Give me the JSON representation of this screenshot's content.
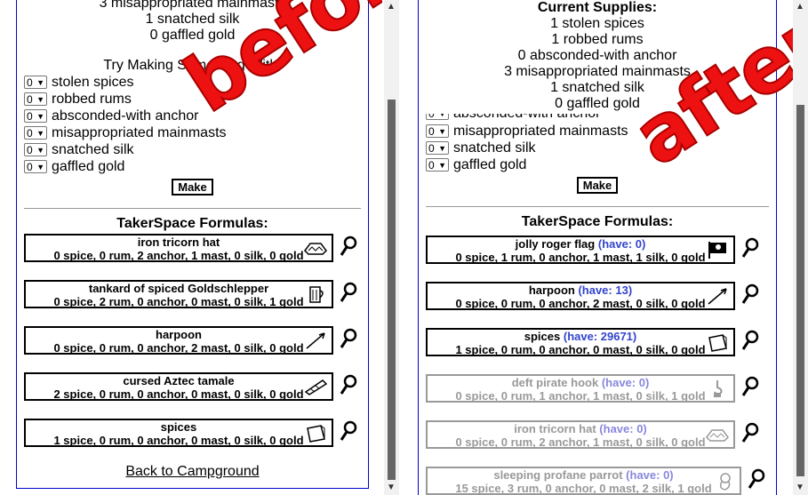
{
  "left": {
    "supplies_partial": [
      "3 misappropriated mainmasts",
      "1 snatched silk",
      "0 gaffled gold"
    ],
    "try_title": "Try Making Something With:",
    "ingredients": [
      {
        "qty": "0",
        "label": "stolen spices"
      },
      {
        "qty": "0",
        "label": "robbed rums"
      },
      {
        "qty": "0",
        "label": "absconded-with anchor"
      },
      {
        "qty": "0",
        "label": "misappropriated mainmasts"
      },
      {
        "qty": "0",
        "label": "snatched silk"
      },
      {
        "qty": "0",
        "label": "gaffled gold"
      }
    ],
    "make_label": "Make",
    "formulas_title": "TakerSpace Formulas:",
    "formulas": [
      {
        "name": "iron tricorn hat",
        "have": "",
        "recipe": "0 spice, 0 rum, 2 anchor, 1 mast, 0 silk, 0 gold",
        "icon": "hat-icon"
      },
      {
        "name": "tankard of spiced Goldschlepper",
        "have": "",
        "recipe": "0 spice, 2 rum, 0 anchor, 0 mast, 0 silk, 1 gold",
        "icon": "tankard-icon"
      },
      {
        "name": "harpoon",
        "have": "",
        "recipe": "0 spice, 0 rum, 0 anchor, 2 mast, 0 silk, 0 gold",
        "icon": "harpoon-icon"
      },
      {
        "name": "cursed Aztec tamale",
        "have": "",
        "recipe": "2 spice, 0 rum, 0 anchor, 0 mast, 0 silk, 0 gold",
        "icon": "tamale-icon"
      },
      {
        "name": "spices",
        "have": "",
        "recipe": "1 spice, 0 rum, 0 anchor, 0 mast, 0 silk, 0 gold",
        "icon": "spice-bag-icon"
      }
    ],
    "back_link": "Back to Campground",
    "overlay_text": "before"
  },
  "right": {
    "supplies_title": "Current Supplies:",
    "supplies": [
      "1 stolen spices",
      "1 robbed rums",
      "0 absconded-with anchor",
      "3 misappropriated mainmasts",
      "1 snatched silk",
      "0 gaffled gold"
    ],
    "ingredients_partial": [
      {
        "qty": "0",
        "label": "absconded-with anchor"
      },
      {
        "qty": "0",
        "label": "misappropriated mainmasts"
      },
      {
        "qty": "0",
        "label": "snatched silk"
      },
      {
        "qty": "0",
        "label": "gaffled gold"
      }
    ],
    "make_label": "Make",
    "formulas_title": "TakerSpace Formulas:",
    "formulas": [
      {
        "name": "jolly roger flag",
        "have": "(have: 0)",
        "recipe": "0 spice, 1 rum, 0 anchor, 1 mast, 1 silk, 0 gold",
        "icon": "flag-icon",
        "grey": false
      },
      {
        "name": "harpoon",
        "have": "(have: 13)",
        "recipe": "0 spice, 0 rum, 0 anchor, 2 mast, 0 silk, 0 gold",
        "icon": "harpoon-icon",
        "grey": false
      },
      {
        "name": "spices",
        "have": "(have: 29671)",
        "recipe": "1 spice, 0 rum, 0 anchor, 0 mast, 0 silk, 0 gold",
        "icon": "spice-bag-icon",
        "grey": false
      },
      {
        "name": "deft pirate hook",
        "have": "(have: 0)",
        "recipe": "0 spice, 0 rum, 1 anchor, 1 mast, 0 silk, 1 gold",
        "icon": "hook-icon",
        "grey": true
      },
      {
        "name": "iron tricorn hat",
        "have": "(have: 0)",
        "recipe": "0 spice, 0 rum, 2 anchor, 1 mast, 0 silk, 0 gold",
        "icon": "hat-icon",
        "grey": true
      },
      {
        "name": "sleeping profane parrot",
        "have": "(have: 0)",
        "recipe": "15 spice, 3 rum, 0 anchor, 0 mast, 2 silk, 1 gold",
        "icon": "parrot-icon",
        "grey": true
      }
    ],
    "overlay_text": "after"
  }
}
